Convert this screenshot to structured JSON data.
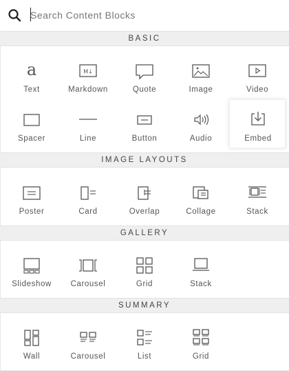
{
  "search": {
    "placeholder": "Search Content Blocks",
    "value": ""
  },
  "sections": {
    "basic": {
      "title": "BASIC",
      "items": [
        {
          "label": "Text",
          "icon": "text-icon"
        },
        {
          "label": "Markdown",
          "icon": "markdown-icon"
        },
        {
          "label": "Quote",
          "icon": "quote-icon"
        },
        {
          "label": "Image",
          "icon": "image-icon"
        },
        {
          "label": "Video",
          "icon": "video-icon"
        },
        {
          "label": "Spacer",
          "icon": "spacer-icon"
        },
        {
          "label": "Line",
          "icon": "line-icon"
        },
        {
          "label": "Button",
          "icon": "button-icon"
        },
        {
          "label": "Audio",
          "icon": "audio-icon"
        },
        {
          "label": "Embed",
          "icon": "embed-icon",
          "selected": true
        }
      ]
    },
    "image_layouts": {
      "title": "IMAGE LAYOUTS",
      "items": [
        {
          "label": "Poster",
          "icon": "poster-icon"
        },
        {
          "label": "Card",
          "icon": "card-icon"
        },
        {
          "label": "Overlap",
          "icon": "overlap-icon"
        },
        {
          "label": "Collage",
          "icon": "collage-icon"
        },
        {
          "label": "Stack",
          "icon": "stack-icon"
        }
      ]
    },
    "gallery": {
      "title": "GALLERY",
      "items": [
        {
          "label": "Slideshow",
          "icon": "slideshow-icon"
        },
        {
          "label": "Carousel",
          "icon": "carousel-icon"
        },
        {
          "label": "Grid",
          "icon": "grid-icon"
        },
        {
          "label": "Stack",
          "icon": "gallery-stack-icon"
        }
      ]
    },
    "summary": {
      "title": "SUMMARY",
      "items": [
        {
          "label": "Wall",
          "icon": "wall-icon"
        },
        {
          "label": "Carousel",
          "icon": "summary-carousel-icon"
        },
        {
          "label": "List",
          "icon": "list-icon"
        },
        {
          "label": "Grid",
          "icon": "summary-grid-icon"
        }
      ]
    }
  },
  "colors": {
    "header_bg": "#efefef",
    "icon_stroke": "#555555",
    "text": "#555555"
  }
}
